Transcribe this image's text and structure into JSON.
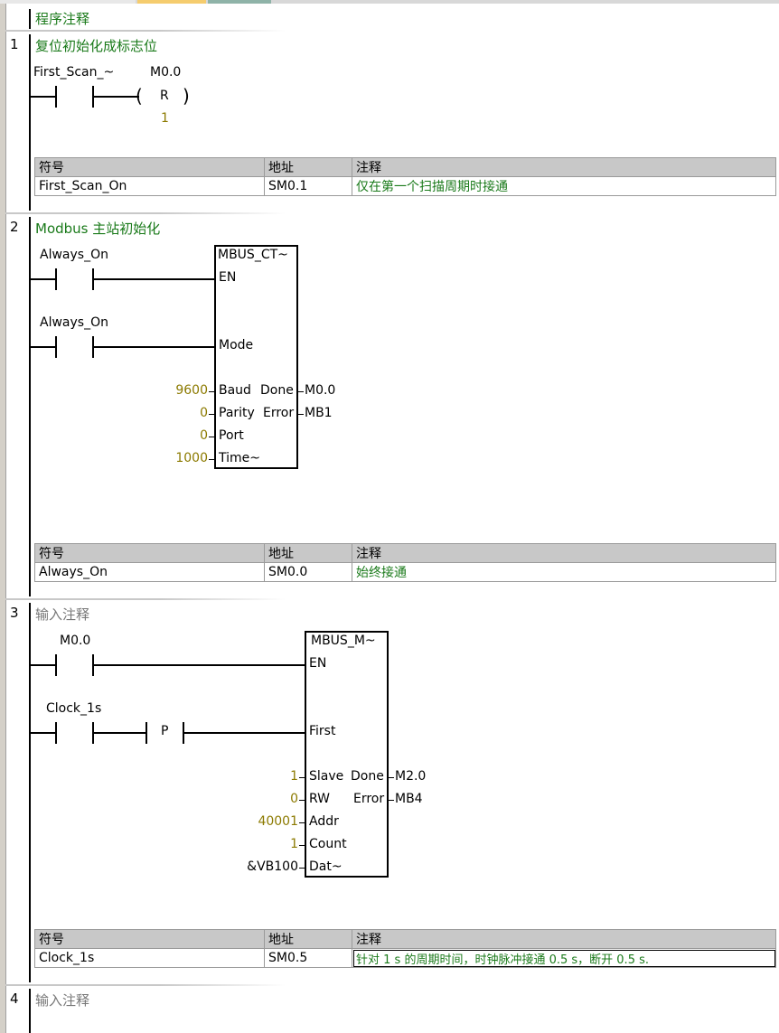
{
  "program_comment": "程序注释",
  "networks": [
    {
      "number": "1",
      "comment": "复位初始化成标志位",
      "contact_label": "First_Scan_~",
      "coil": {
        "address": "M0.0",
        "type": "R",
        "count": "1"
      },
      "symbols": {
        "headers": [
          "符号",
          "地址",
          "注释"
        ],
        "rows": [
          {
            "symbol": "First_Scan_On",
            "address": "SM0.1",
            "comment": "仅在第一个扫描周期时接通"
          }
        ]
      }
    },
    {
      "number": "2",
      "comment": "Modbus 主站初始化",
      "contacts": [
        "Always_On",
        "Always_On"
      ],
      "block": {
        "name": "MBUS_CT~",
        "inputs": [
          "EN",
          "Mode",
          "Baud",
          "Parity",
          "Port",
          "Time~"
        ],
        "outputs": [
          "Done",
          "Error"
        ],
        "input_values": {
          "baud": "9600",
          "parity": "0",
          "port": "0",
          "time": "1000"
        },
        "output_values": {
          "done": "M0.0",
          "error": "MB1"
        }
      },
      "symbols": {
        "headers": [
          "符号",
          "地址",
          "注释"
        ],
        "rows": [
          {
            "symbol": "Always_On",
            "address": "SM0.0",
            "comment": "始终接通"
          }
        ]
      }
    },
    {
      "number": "3",
      "comment": "输入注释",
      "contacts": [
        "M0.0",
        "Clock_1s"
      ],
      "edge_label": "P",
      "block": {
        "name": "MBUS_M~",
        "inputs": [
          "EN",
          "First",
          "Slave",
          "RW",
          "Addr",
          "Count",
          "Dat~"
        ],
        "outputs": [
          "Done",
          "Error"
        ],
        "input_values": {
          "slave": "1",
          "rw": "0",
          "addr": "40001",
          "count": "1",
          "dat": "&VB100"
        },
        "output_values": {
          "done": "M2.0",
          "error": "MB4"
        }
      },
      "symbols": {
        "headers": [
          "符号",
          "地址",
          "注释"
        ],
        "rows": [
          {
            "symbol": "Clock_1s",
            "address": "SM0.5",
            "comment": "针对 1 s 的周期时间，时钟脉冲接通 0.5 s，断开 0.5 s."
          }
        ]
      }
    },
    {
      "number": "4",
      "comment": "输入注释"
    }
  ]
}
